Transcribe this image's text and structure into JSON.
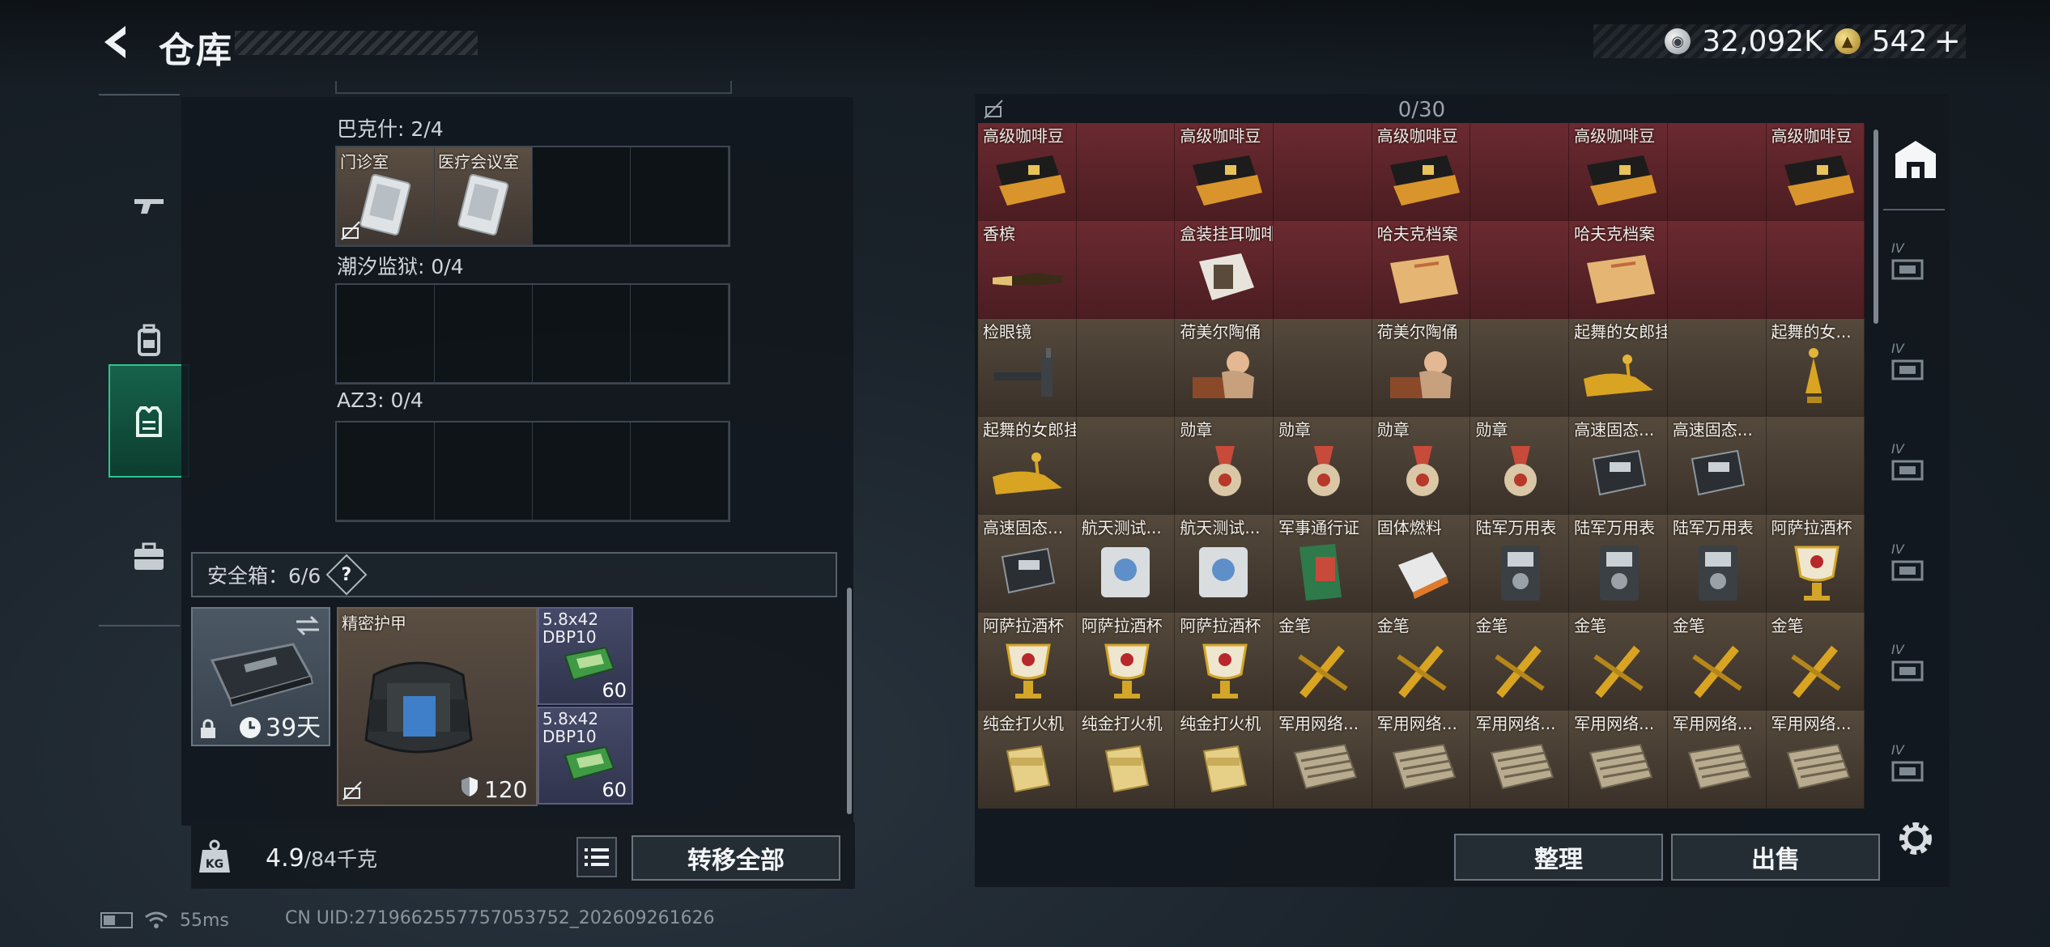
{
  "header": {
    "title": "仓库",
    "currency_primary": "32,092K",
    "currency_secondary": "542",
    "add_symbol": "+"
  },
  "left_nav": [
    "firearm-icon",
    "backpack-icon",
    "vest-icon",
    "briefcase-icon"
  ],
  "left_panel": {
    "sections": [
      {
        "label": "巴克什: 2/4",
        "items": [
          {
            "name": "门诊室"
          },
          {
            "name": "医疗会议室"
          }
        ]
      },
      {
        "label": "潮汐监狱: 0/4",
        "items": []
      },
      {
        "label": "AZ3: 0/4",
        "items": []
      }
    ],
    "safe_box": {
      "label": "安全箱：6/6",
      "help": "?",
      "duration": "39天"
    },
    "armor": {
      "name": "精密护甲",
      "durability": "120"
    },
    "ammo": [
      {
        "name": "5.8x42\nDBP10",
        "qty": "60"
      },
      {
        "name": "5.8x42\nDBP10",
        "qty": "60"
      }
    ],
    "weight": {
      "current": "4.9",
      "max": "/84千克"
    },
    "transfer_all": "转移全部"
  },
  "status": {
    "ping": "55ms",
    "uid": "CN UID:2719662557757053752_202609261626"
  },
  "right_panel": {
    "count": "0/30",
    "sort_button": "整理",
    "sell_button": "出售",
    "rows": [
      [
        {
          "label": "高级咖啡豆",
          "icon": "coffee-bag-icon",
          "quality": "red"
        },
        {
          "label": "",
          "icon": "",
          "quality": "red"
        },
        {
          "label": "高级咖啡豆",
          "icon": "coffee-bag-icon",
          "quality": "red"
        },
        {
          "label": "",
          "icon": "",
          "quality": "red"
        },
        {
          "label": "高级咖啡豆",
          "icon": "coffee-bag-icon",
          "quality": "red"
        },
        {
          "label": "",
          "icon": "",
          "quality": "red"
        },
        {
          "label": "高级咖啡豆",
          "icon": "coffee-bag-icon",
          "quality": "red"
        },
        {
          "label": "",
          "icon": "",
          "quality": "red"
        },
        {
          "label": "高级咖啡豆",
          "icon": "coffee-bag-icon",
          "quality": "red"
        }
      ],
      [
        {
          "label": "香槟",
          "icon": "champagne-icon",
          "quality": "red"
        },
        {
          "label": "",
          "icon": "",
          "quality": "red"
        },
        {
          "label": "盒装挂耳咖啡",
          "icon": "coffee-box-icon",
          "quality": "red"
        },
        {
          "label": "",
          "icon": "",
          "quality": "red"
        },
        {
          "label": "哈夫克档案",
          "icon": "dossier-icon",
          "quality": "red"
        },
        {
          "label": "",
          "icon": "",
          "quality": "red"
        },
        {
          "label": "哈夫克档案",
          "icon": "dossier-icon",
          "quality": "red"
        },
        {
          "label": "",
          "icon": "",
          "quality": "red"
        },
        {
          "label": "",
          "icon": "",
          "quality": "red"
        }
      ],
      [
        {
          "label": "检眼镜",
          "icon": "ophthalmoscope-icon",
          "quality": "gold"
        },
        {
          "label": "",
          "icon": "",
          "quality": "gold"
        },
        {
          "label": "荷美尔陶俑",
          "icon": "figurine-icon",
          "quality": "gold"
        },
        {
          "label": "",
          "icon": "",
          "quality": "gold"
        },
        {
          "label": "荷美尔陶俑",
          "icon": "figurine-icon",
          "quality": "gold"
        },
        {
          "label": "",
          "icon": "",
          "quality": "gold"
        },
        {
          "label": "起舞的女郎挂饰",
          "icon": "dancer-ornament-icon",
          "quality": "gold"
        },
        {
          "label": "",
          "icon": "",
          "quality": "gold"
        },
        {
          "label": "起舞的女...",
          "icon": "dancer-statue-icon",
          "quality": "gold"
        }
      ],
      [
        {
          "label": "起舞的女郎挂饰",
          "icon": "dancer-ornament-icon",
          "quality": "gold"
        },
        {
          "label": "",
          "icon": "",
          "quality": "gold"
        },
        {
          "label": "勋章",
          "icon": "medal-icon",
          "quality": "gold"
        },
        {
          "label": "勋章",
          "icon": "medal-icon",
          "quality": "gold"
        },
        {
          "label": "勋章",
          "icon": "medal-icon",
          "quality": "gold"
        },
        {
          "label": "勋章",
          "icon": "medal-icon",
          "quality": "gold"
        },
        {
          "label": "高速固态...",
          "icon": "ssd-icon",
          "quality": "gold"
        },
        {
          "label": "高速固态...",
          "icon": "ssd-icon",
          "quality": "gold"
        },
        {
          "label": "",
          "icon": "",
          "quality": "gold"
        }
      ],
      [
        {
          "label": "高速固态...",
          "icon": "ssd-icon",
          "quality": "gold"
        },
        {
          "label": "航天测试...",
          "icon": "test-device-icon",
          "quality": "gold"
        },
        {
          "label": "航天测试...",
          "icon": "test-device-icon",
          "quality": "gold"
        },
        {
          "label": "军事通行证",
          "icon": "pass-icon",
          "quality": "gold"
        },
        {
          "label": "固体燃料",
          "icon": "fuel-icon",
          "quality": "gold"
        },
        {
          "label": "陆军万用表",
          "icon": "multimeter-icon",
          "quality": "gold"
        },
        {
          "label": "陆军万用表",
          "icon": "multimeter-icon",
          "quality": "gold"
        },
        {
          "label": "陆军万用表",
          "icon": "multimeter-icon",
          "quality": "gold"
        },
        {
          "label": "阿萨拉酒杯",
          "icon": "goblet-icon",
          "quality": "gold"
        }
      ],
      [
        {
          "label": "阿萨拉酒杯",
          "icon": "goblet-icon",
          "quality": "gold"
        },
        {
          "label": "阿萨拉酒杯",
          "icon": "goblet-icon",
          "quality": "gold"
        },
        {
          "label": "阿萨拉酒杯",
          "icon": "goblet-icon",
          "quality": "gold"
        },
        {
          "label": "金笔",
          "icon": "gold-pen-icon",
          "quality": "gold"
        },
        {
          "label": "金笔",
          "icon": "gold-pen-icon",
          "quality": "gold"
        },
        {
          "label": "金笔",
          "icon": "gold-pen-icon",
          "quality": "gold"
        },
        {
          "label": "金笔",
          "icon": "gold-pen-icon",
          "quality": "gold"
        },
        {
          "label": "金笔",
          "icon": "gold-pen-icon",
          "quality": "gold"
        },
        {
          "label": "金笔",
          "icon": "gold-pen-icon",
          "quality": "gold"
        }
      ],
      [
        {
          "label": "纯金打火机",
          "icon": "lighter-icon",
          "quality": "gold"
        },
        {
          "label": "纯金打火机",
          "icon": "lighter-icon",
          "quality": "gold"
        },
        {
          "label": "纯金打火机",
          "icon": "lighter-icon",
          "quality": "gold"
        },
        {
          "label": "军用网络...",
          "icon": "network-device-icon",
          "quality": "gold"
        },
        {
          "label": "军用网络...",
          "icon": "network-device-icon",
          "quality": "gold"
        },
        {
          "label": "军用网络...",
          "icon": "network-device-icon",
          "quality": "gold"
        },
        {
          "label": "军用网络...",
          "icon": "network-device-icon",
          "quality": "gold"
        },
        {
          "label": "军用网络...",
          "icon": "network-device-icon",
          "quality": "gold"
        },
        {
          "label": "军用网络...",
          "icon": "network-device-icon",
          "quality": "gold"
        }
      ]
    ]
  },
  "right_rail": {
    "top_icon": "warehouse-icon",
    "tiers": [
      "IV",
      "IV",
      "IV",
      "IV",
      "IV",
      "IV"
    ]
  }
}
